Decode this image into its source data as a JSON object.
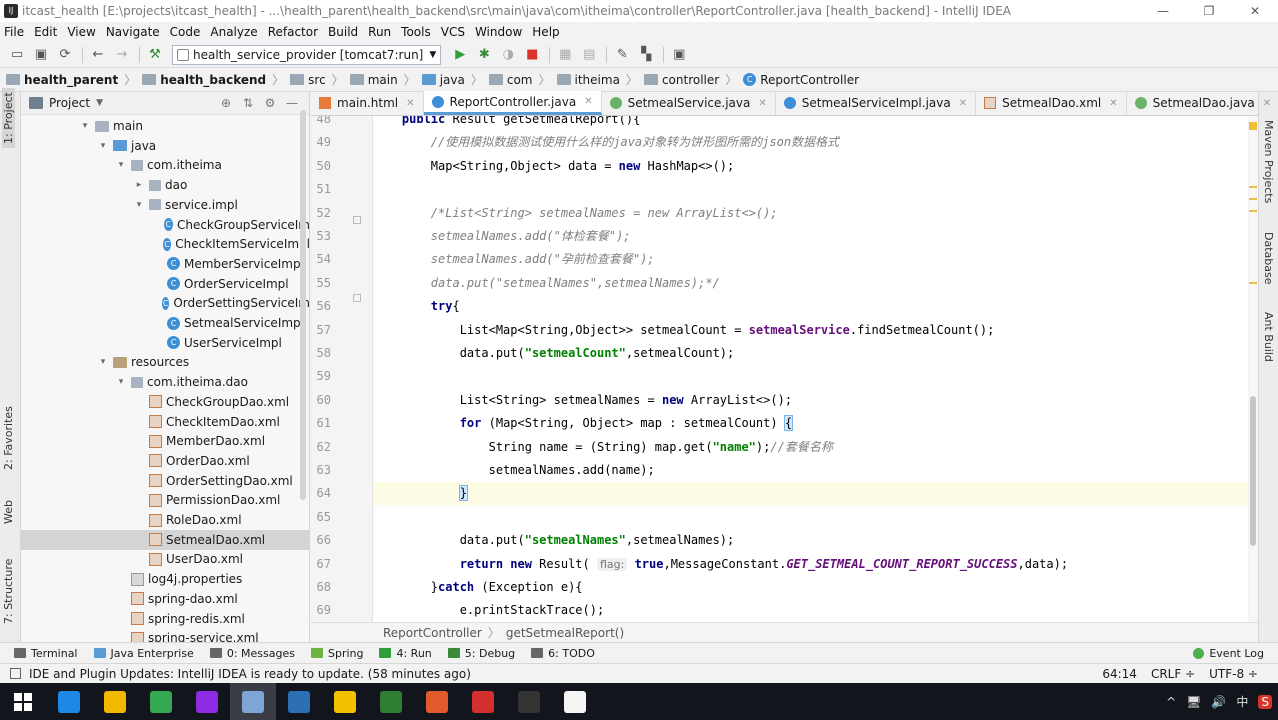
{
  "window": {
    "title": "itcast_health [E:\\projects\\itcast_health] - ...\\health_parent\\health_backend\\src\\main\\java\\com\\itheima\\controller\\ReportController.java [health_backend] - IntelliJ IDEA",
    "buttons": [
      "—",
      "❐",
      "✕"
    ]
  },
  "menu": [
    "File",
    "Edit",
    "View",
    "Navigate",
    "Code",
    "Analyze",
    "Refactor",
    "Build",
    "Run",
    "Tools",
    "VCS",
    "Window",
    "Help"
  ],
  "toolbar": {
    "run_config": "health_service_provider [tomcat7:run]"
  },
  "breadcrumbs": [
    "health_parent",
    "health_backend",
    "src",
    "main",
    "java",
    "com",
    "itheima",
    "controller",
    "ReportController"
  ],
  "left_stripe": [
    "1: Project",
    "2: Favorites",
    "Web",
    "7: Structure"
  ],
  "right_stripe": [
    "Maven Projects",
    "Database",
    "Ant Build"
  ],
  "project": {
    "header": "Project",
    "tree": [
      {
        "label": "main",
        "kind": "folder",
        "depth": 0,
        "arrow": "▾"
      },
      {
        "label": "java",
        "kind": "folder",
        "depth": 1,
        "arrow": "▾"
      },
      {
        "label": "com.itheima",
        "kind": "pkg",
        "depth": 2,
        "arrow": "▾"
      },
      {
        "label": "dao",
        "kind": "pkg",
        "depth": 3,
        "arrow": "▸"
      },
      {
        "label": "service.impl",
        "kind": "pkg",
        "depth": 3,
        "arrow": "▾"
      },
      {
        "label": "CheckGroupServiceIm",
        "kind": "class",
        "depth": 4
      },
      {
        "label": "CheckItemServiceImpl",
        "kind": "class",
        "depth": 4
      },
      {
        "label": "MemberServiceImpl",
        "kind": "class",
        "depth": 4
      },
      {
        "label": "OrderServiceImpl",
        "kind": "class",
        "depth": 4
      },
      {
        "label": "OrderSettingServiceIm",
        "kind": "class",
        "depth": 4
      },
      {
        "label": "SetmealServiceImpl",
        "kind": "class",
        "depth": 4
      },
      {
        "label": "UserServiceImpl",
        "kind": "class",
        "depth": 4
      },
      {
        "label": "resources",
        "kind": "folder",
        "depth": 1,
        "arrow": "▾"
      },
      {
        "label": "com.itheima.dao",
        "kind": "pkg",
        "depth": 2,
        "arrow": "▾"
      },
      {
        "label": "CheckGroupDao.xml",
        "kind": "xml",
        "depth": 3
      },
      {
        "label": "CheckItemDao.xml",
        "kind": "xml",
        "depth": 3
      },
      {
        "label": "MemberDao.xml",
        "kind": "xml",
        "depth": 3
      },
      {
        "label": "OrderDao.xml",
        "kind": "xml",
        "depth": 3
      },
      {
        "label": "OrderSettingDao.xml",
        "kind": "xml",
        "depth": 3
      },
      {
        "label": "PermissionDao.xml",
        "kind": "xml",
        "depth": 3
      },
      {
        "label": "RoleDao.xml",
        "kind": "xml",
        "depth": 3
      },
      {
        "label": "SetmealDao.xml",
        "kind": "xml",
        "depth": 3,
        "selected": true
      },
      {
        "label": "UserDao.xml",
        "kind": "xml",
        "depth": 3
      },
      {
        "label": "log4j.properties",
        "kind": "props",
        "depth": 2
      },
      {
        "label": "spring-dao.xml",
        "kind": "xml",
        "depth": 2
      },
      {
        "label": "spring-redis.xml",
        "kind": "xml",
        "depth": 2
      },
      {
        "label": "spring-service.xml",
        "kind": "xml",
        "depth": 2
      }
    ]
  },
  "tabs": [
    {
      "label": "main.html",
      "type": "html"
    },
    {
      "label": "ReportController.java",
      "type": "cls",
      "active": true
    },
    {
      "label": "SetmealService.java",
      "type": "int"
    },
    {
      "label": "SetmealServiceImpl.java",
      "type": "cls"
    },
    {
      "label": "SetmealDao.xml",
      "type": "xml"
    },
    {
      "label": "SetmealDao.java",
      "type": "int"
    }
  ],
  "tabs_more": "≡4",
  "code": {
    "current_line": 64,
    "lines": [
      {
        "n": 48,
        "html": "    <span class=\"kw\">public</span> Result getSetmealReport(){"
      },
      {
        "n": 49,
        "html": "        <span class=\"cmt\">//使用模拟数据测试使用什么样的java对象转为饼形图所需的json数据格式</span>"
      },
      {
        "n": 50,
        "html": "        Map&lt;String,Object&gt; data = <span class=\"kw\">new</span> HashMap&lt;&gt;();"
      },
      {
        "n": 51,
        "html": ""
      },
      {
        "n": 52,
        "html": "        <span class=\"cmt\">/*List&lt;String&gt; setmealNames = new ArrayList&lt;&gt;();</span>"
      },
      {
        "n": 53,
        "html": "        <span class=\"cmt\">setmealNames.add(\"体检套餐\");</span>"
      },
      {
        "n": 54,
        "html": "        <span class=\"cmt\">setmealNames.add(\"孕前检查套餐\");</span>"
      },
      {
        "n": 55,
        "html": "        <span class=\"cmt\">data.put(\"setmealNames\",setmealNames);*/</span>"
      },
      {
        "n": 56,
        "html": "        <span class=\"kw\">try</span>{"
      },
      {
        "n": 57,
        "html": "            List&lt;Map&lt;String,Object&gt;&gt; setmealCount = <span class=\"fld\">setmealService</span>.findSetmealCount();"
      },
      {
        "n": 58,
        "html": "            data.put(<span class=\"str\">\"setmealCount\"</span>,setmealCount);"
      },
      {
        "n": 59,
        "html": ""
      },
      {
        "n": 60,
        "html": "            List&lt;String&gt; setmealNames = <span class=\"kw\">new</span> ArrayList&lt;&gt;();"
      },
      {
        "n": 61,
        "html": "            <span class=\"kw\">for</span> (Map&lt;String, Object&gt; map : setmealCount) <span class=\"brace-match\">{</span>"
      },
      {
        "n": 62,
        "html": "                String name = (String) map.get(<span class=\"str\">\"name\"</span>);<span class=\"cmt\">//套餐名称</span>"
      },
      {
        "n": 63,
        "html": "                setmealNames.add(name);"
      },
      {
        "n": 64,
        "html": "            <span class=\"brace-match\">}</span>"
      },
      {
        "n": 65,
        "html": ""
      },
      {
        "n": 66,
        "html": "            data.put(<span class=\"str\">\"setmealNames\"</span>,setmealNames);"
      },
      {
        "n": 67,
        "html": "            <span class=\"kw\">return new</span> Result( <span class=\"hint\">flag:</span> <span class=\"kw\">true</span>,MessageConstant.<span class=\"fldi\">GET_SETMEAL_COUNT_REPORT_SUCCESS</span>,data);"
      },
      {
        "n": 68,
        "html": "        }<span class=\"kw\">catch</span> (Exception e){"
      },
      {
        "n": 69,
        "html": "            e.printStackTrace();"
      }
    ]
  },
  "editor_breadcrumb": [
    "ReportController",
    "getSetmealReport()"
  ],
  "tool_windows": [
    "Terminal",
    "Java Enterprise",
    "0: Messages",
    "Spring",
    "4: Run",
    "5: Debug",
    "6: TODO"
  ],
  "event_log": "Event Log",
  "status": {
    "message": "IDE and Plugin Updates: IntelliJ IDEA is ready to update. (58 minutes ago)",
    "position": "64:14",
    "line_sep": "CRLF ÷",
    "encoding": "UTF-8 ÷"
  },
  "taskbar": {
    "apps": [
      "#1e88e5",
      "#f5b800",
      "#34a853",
      "#8e2be2",
      "#7da6d6",
      "#2c6fb5",
      "#f2c200",
      "#2e7d32",
      "#e05a2b",
      "#d32f2f",
      "#333333",
      "#f5f5f5"
    ],
    "tray": [
      "^",
      "🖥",
      "🔊",
      "中",
      "S"
    ]
  },
  "colors": {
    "accent": "#5a9bd5",
    "keyword": "#000080",
    "string": "#008000",
    "field": "#660e7a"
  }
}
